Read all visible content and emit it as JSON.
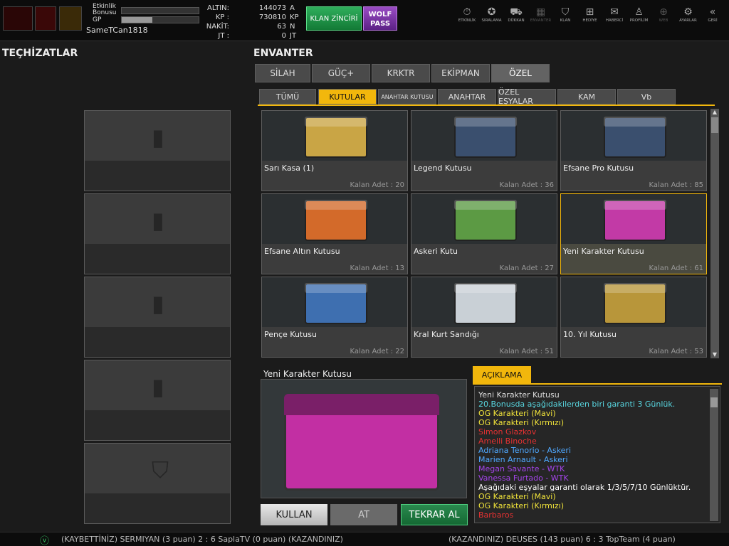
{
  "player": {
    "name": "SameTCan1818",
    "bonus_label": "Etkinlik\nBonusu",
    "gp_label": "GP",
    "bonus_progress": 0.0,
    "gp_progress": 0.4
  },
  "currency": [
    {
      "label": "ALTIN:",
      "value": "144073",
      "unit": "A"
    },
    {
      "label": "KP :",
      "value": "730810",
      "unit": "KP"
    },
    {
      "label": "NAKİT:",
      "value": "63",
      "unit": "N"
    },
    {
      "label": "JT :",
      "value": "0",
      "unit": "JT"
    }
  ],
  "buttons": {
    "klan_zinciri": "KLAN ZİNCİRİ",
    "wolf_pass": "WOLF\nPASS"
  },
  "top_nav": [
    {
      "label": "ETKİNLİK",
      "icon": "stopwatch-icon",
      "glyph": "⏱",
      "dim": false
    },
    {
      "label": "SIRALAMA",
      "icon": "medal-icon",
      "glyph": "✪",
      "dim": false
    },
    {
      "label": "DÜKKAN",
      "icon": "cart-icon",
      "glyph": "⛟",
      "dim": false
    },
    {
      "label": "ENVANTER",
      "icon": "inventory-icon",
      "glyph": "▦",
      "dim": true
    },
    {
      "label": "KLAN",
      "icon": "shield-icon",
      "glyph": "⛉",
      "dim": false
    },
    {
      "label": "HEDİYE",
      "icon": "gift-icon",
      "glyph": "⊞",
      "dim": false
    },
    {
      "label": "HABERCİ",
      "icon": "megaphone-icon",
      "glyph": "✉",
      "dim": false
    },
    {
      "label": "PROFİLİM",
      "icon": "profile-icon",
      "glyph": "♙",
      "dim": false
    },
    {
      "label": "WEB",
      "icon": "globe-icon",
      "glyph": "⊕",
      "dim": true
    },
    {
      "label": "AYARLAR",
      "icon": "gear-icon",
      "glyph": "⚙",
      "dim": false
    },
    {
      "label": "GERİ",
      "icon": "back-icon",
      "glyph": "«",
      "dim": false
    }
  ],
  "left_title": "TEÇHİZATLAR",
  "right_title": "ENVANTER",
  "main_tabs": [
    "SİLAH",
    "GÜÇ+",
    "KRKTR",
    "EKİPMAN",
    "ÖZEL"
  ],
  "active_main_tab": "ÖZEL",
  "sub_tabs": [
    "TÜMÜ",
    "KUTULAR",
    "ANAHTAR KUTUSU",
    "ANAHTAR",
    "ÖZEL EŞYALAR",
    "KAM",
    "Vb"
  ],
  "active_sub_tab": "KUTULAR",
  "items": [
    {
      "name": "Sarı Kasa (1)",
      "count": "Kalan Adet : 20",
      "color": "#c9a545"
    },
    {
      "name": "Legend Kutusu",
      "count": "Kalan Adet : 36",
      "color": "#3a4f6e"
    },
    {
      "name": "Efsane Pro Kutusu",
      "count": "Kalan Adet : 85",
      "color": "#3a4f6e"
    },
    {
      "name": "Efsane Altın Kutusu",
      "count": "Kalan Adet : 13",
      "color": "#d36a2a"
    },
    {
      "name": "Askeri Kutu",
      "count": "Kalan Adet : 27",
      "color": "#5c9a44"
    },
    {
      "name": "Yeni Karakter Kutusu",
      "count": "Kalan Adet : 61",
      "color": "#c23aa6"
    },
    {
      "name": "Pençe Kutusu",
      "count": "Kalan Adet : 22",
      "color": "#3e6fb0"
    },
    {
      "name": "Kral Kurt Sandığı",
      "count": "Kalan Adet : 51",
      "color": "#c9d0d6"
    },
    {
      "name": "10. Yıl Kutusu",
      "count": "Kalan Adet : 53",
      "color": "#b8963a"
    }
  ],
  "selected_item": "Yeni Karakter Kutusu",
  "preview_title": "Yeni Karakter Kutusu",
  "actions": {
    "use": "KULLAN",
    "drop": "AT",
    "rebuy": "TEKRAR AL"
  },
  "description": {
    "tab": "AÇIKLAMA",
    "lines": [
      {
        "text": "Yeni Karakter Kutusu",
        "color": "#dddddd"
      },
      {
        "text": "20.Bonusda aşağıdakilerden biri garanti 3 Günlük.",
        "color": "#58d6e0"
      },
      {
        "text": "OG Karakteri (Mavi)",
        "color": "#f0e33a"
      },
      {
        "text": "OG Karakteri (Kırmızı)",
        "color": "#f0e33a"
      },
      {
        "text": "Simon Glazkov",
        "color": "#e63232"
      },
      {
        "text": "Amelli Binoche",
        "color": "#e63232"
      },
      {
        "text": "Adriana Tenorio - Askeri",
        "color": "#4fa8ff"
      },
      {
        "text": "Marien Arnault - Askeri",
        "color": "#4fa8ff"
      },
      {
        "text": "Megan Savante - WTK",
        "color": "#a244e8"
      },
      {
        "text": "Vanessa Furtado - WTK",
        "color": "#a244e8"
      },
      {
        "text": "Aşağıdaki eşyalar garanti olarak 1/3/5/7/10 Günlüktür.",
        "color": "#ffffff"
      },
      {
        "text": "OG Karakteri (Mavi)",
        "color": "#f0e33a"
      },
      {
        "text": "OG Karakteri (Kırmızı)",
        "color": "#f0e33a"
      },
      {
        "text": "Barbaros",
        "color": "#e63232"
      }
    ]
  },
  "ticker": {
    "left": "(KAYBETTİNİZ) SERMIYAN (3 puan) 2 : 6 SaplaTV (0 puan) (KAZANDINIZ)",
    "right": "(KAZANDINIZ) DEUSES (143 puan) 6 : 3 TopTeam (4 puan)"
  }
}
